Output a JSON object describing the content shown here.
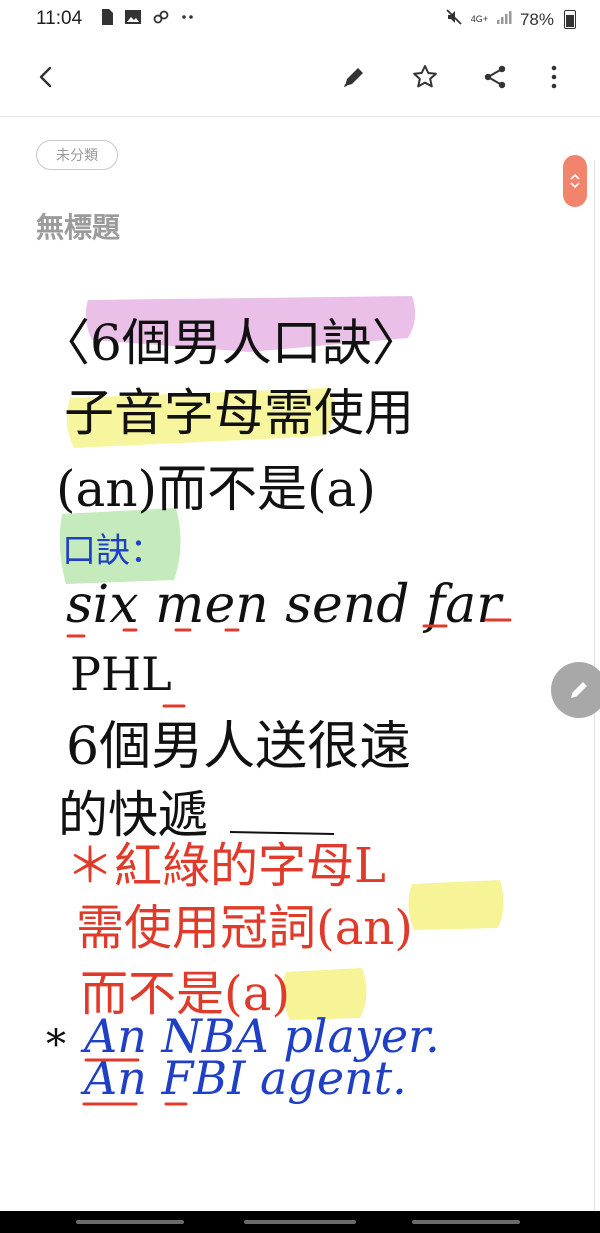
{
  "status_bar": {
    "time": "11:04",
    "notification_icons": [
      "sim-card-icon",
      "image-icon",
      "link-icon",
      "more-dots-icon"
    ],
    "network": "4G+",
    "battery": "78%"
  },
  "toolbar": {
    "icons": [
      "back-arrow-icon",
      "pen-icon",
      "star-icon",
      "share-icon",
      "more-vert-icon"
    ]
  },
  "note": {
    "category": "未分類",
    "title": "無標題",
    "handwriting": {
      "line1": "〈6個男人口訣〉",
      "line2": "子音字母需使用",
      "line3": "(an)而不是(a)",
      "line4": "口訣：",
      "line5": "six men send far",
      "line6": "PHL",
      "line7": "6個男人送很遠",
      "line8": "的快遞",
      "line9": "＊紅綠的字母L",
      "line10": "需使用冠詞(an)",
      "line11": "而不是(a)",
      "line12_star": "*",
      "line12": "An NBA player.",
      "line13": "An FBI agent."
    }
  },
  "colors": {
    "ink_black": "#111111",
    "ink_red": "#e03a2a",
    "ink_blue": "#1f3fc4",
    "highlight_pink": "#d98ad6",
    "highlight_yellow": "#f2ef6a",
    "highlight_green": "#9fdc8f",
    "accent_orange": "#f2846e"
  }
}
